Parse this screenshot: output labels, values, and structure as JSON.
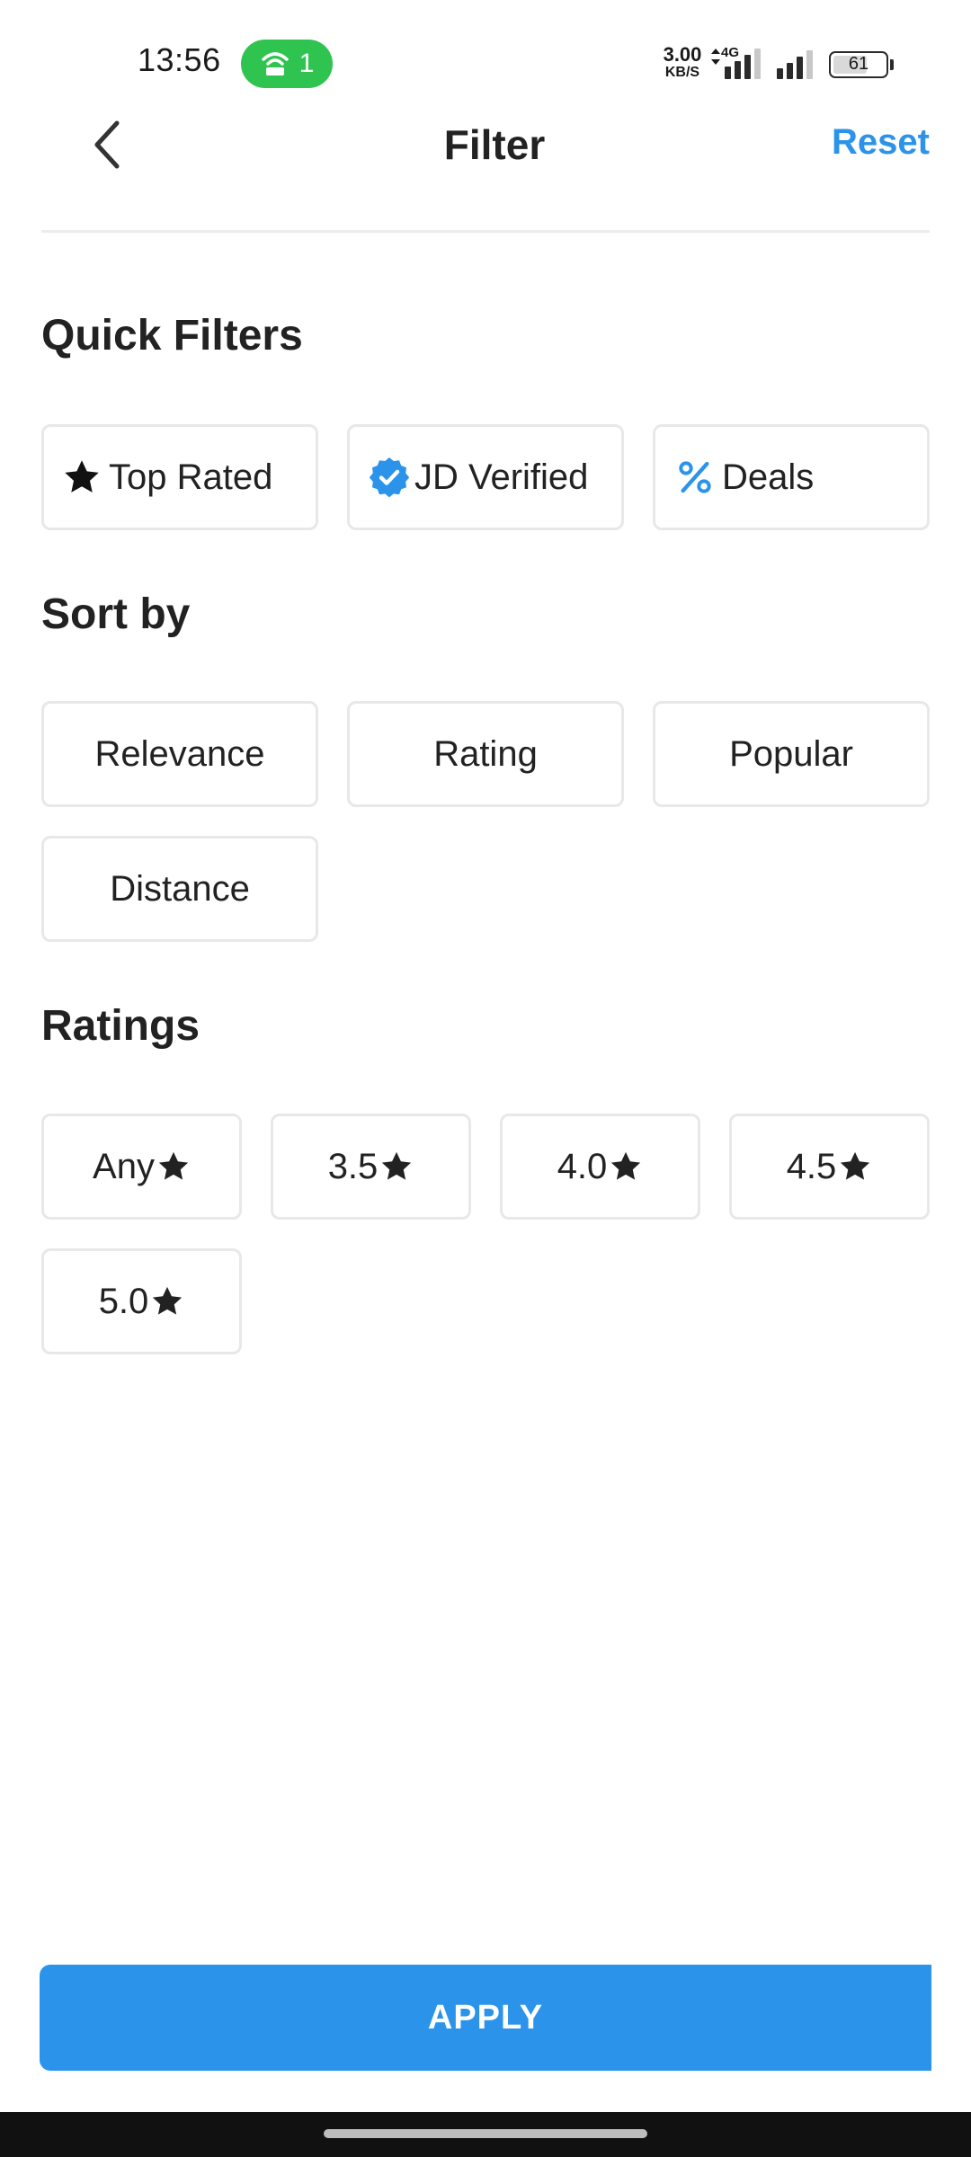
{
  "status_bar": {
    "time": "13:56",
    "hotspot_count": "1",
    "net_speed_value": "3.00",
    "net_speed_unit": "KB/S",
    "network_type": "4G",
    "battery_level": "61"
  },
  "header": {
    "title": "Filter",
    "reset_label": "Reset",
    "back_icon": "chevron-left-icon"
  },
  "quick_filters": {
    "title": "Quick Filters",
    "items": [
      {
        "label": "Top Rated",
        "icon": "star-icon"
      },
      {
        "label": "JD Verified",
        "icon": "verified-badge-icon"
      },
      {
        "label": "Deals",
        "icon": "percent-icon"
      }
    ]
  },
  "sort_by": {
    "title": "Sort by",
    "options": [
      "Relevance",
      "Rating",
      "Popular",
      "Distance"
    ]
  },
  "ratings": {
    "title": "Ratings",
    "options": [
      "Any",
      "3.5",
      "4.0",
      "4.5",
      "5.0"
    ]
  },
  "apply_label": "APPLY",
  "colors": {
    "accent": "#2b94ea",
    "chip_border": "#e8e8e8",
    "hotspot": "#2fc34f"
  }
}
